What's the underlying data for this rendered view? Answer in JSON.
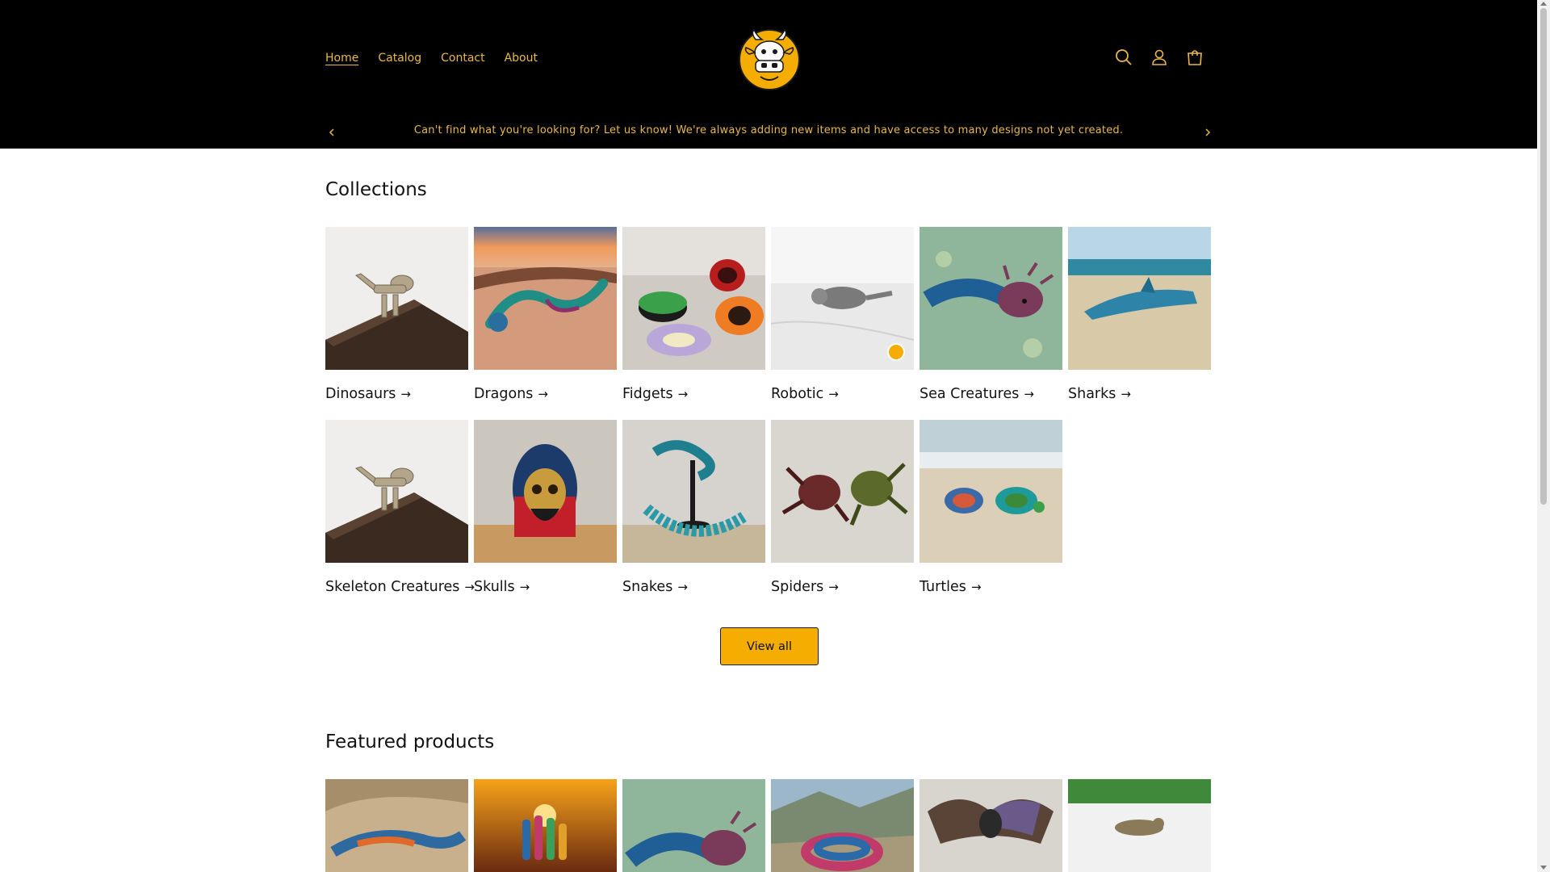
{
  "header": {
    "nav": [
      {
        "label": "Home",
        "active": true
      },
      {
        "label": "Catalog",
        "active": false
      },
      {
        "label": "Contact",
        "active": false
      },
      {
        "label": "About",
        "active": false
      }
    ],
    "logo_icon": "cow-mascot-icon",
    "icons": [
      "search-icon",
      "account-icon",
      "cart-icon"
    ],
    "accent_color": "#e8b84a",
    "background_color": "#000000"
  },
  "announcement": {
    "text": "Can't find what you're looking for? Let us know! We're always adding new items and have access to many designs not yet created."
  },
  "collections": {
    "title": "Collections",
    "arrow": "→",
    "items": [
      {
        "label": "Dinosaurs"
      },
      {
        "label": "Dragons"
      },
      {
        "label": "Fidgets"
      },
      {
        "label": "Robotic"
      },
      {
        "label": "Sea Creatures"
      },
      {
        "label": "Sharks"
      },
      {
        "label": "Skeleton Creatures"
      },
      {
        "label": "Skulls"
      },
      {
        "label": "Snakes"
      },
      {
        "label": "Spiders"
      },
      {
        "label": "Turtles"
      }
    ],
    "view_all": "View all",
    "button_color": "#f4ad00"
  },
  "featured": {
    "title": "Featured products"
  }
}
